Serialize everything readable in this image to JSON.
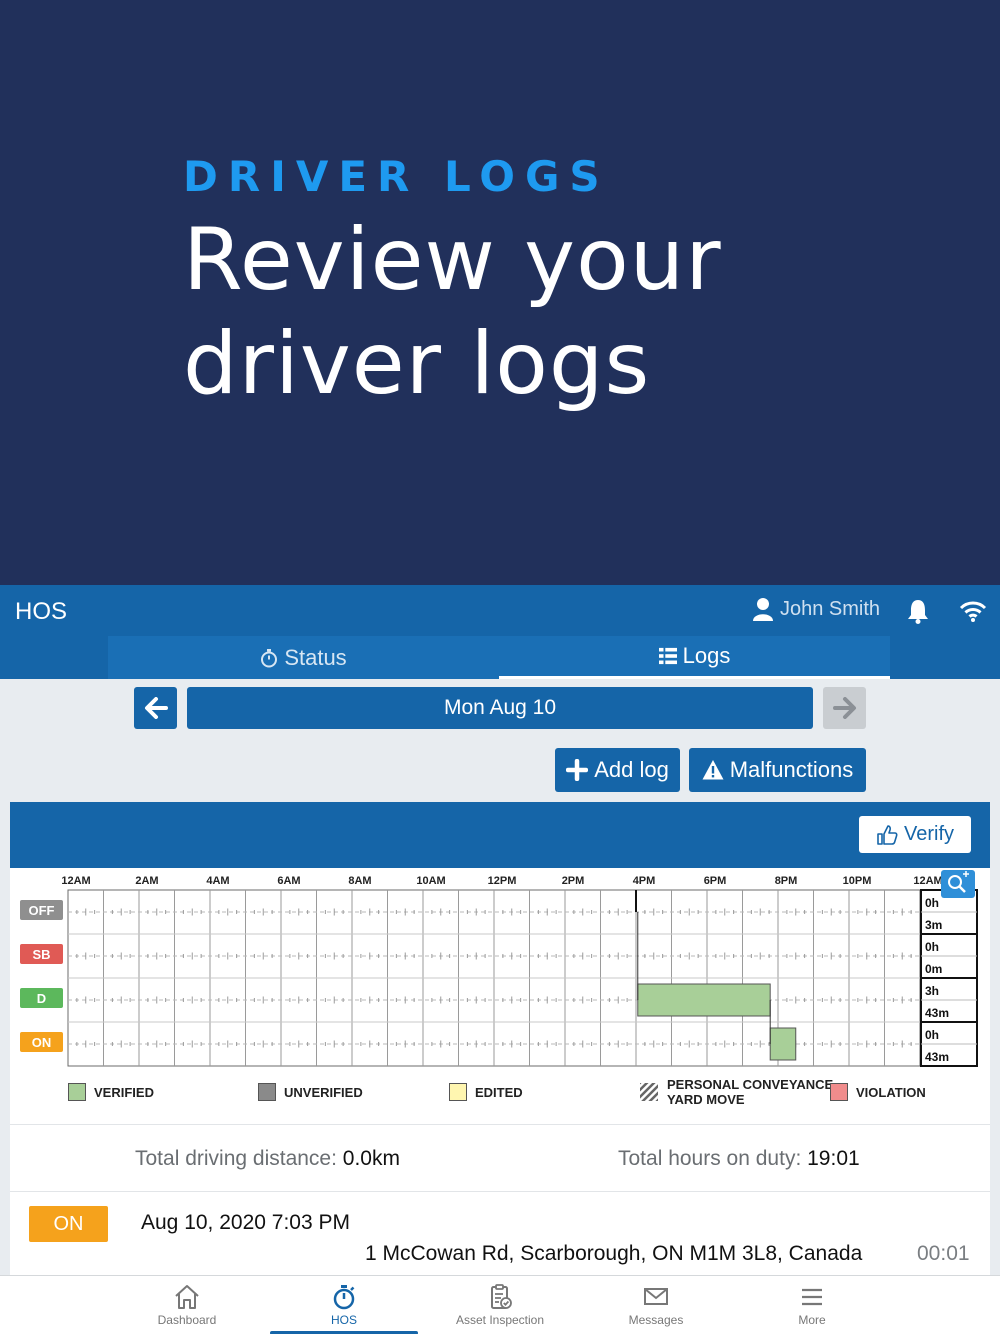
{
  "promo": {
    "kicker": "DRIVER LOGS",
    "title": "Review your driver logs"
  },
  "appbar": {
    "title": "HOS",
    "user_name": "John Smith",
    "user_icon": "user-icon",
    "notification_icon": "bell-icon",
    "connection_icon": "wifi-icon",
    "tabs": [
      {
        "label": "Status",
        "icon": "stopwatch-icon",
        "active": false
      },
      {
        "label": "Logs",
        "icon": "list-icon",
        "active": true
      }
    ]
  },
  "log_nav": {
    "date": "Mon Aug 10",
    "prev_icon": "arrow-left-icon",
    "next_icon": "arrow-right-icon",
    "next_enabled": false
  },
  "actions": {
    "add_log": "Add log",
    "malfunctions": "Malfunctions"
  },
  "verify_label": "Verify",
  "chart_data": {
    "type": "duty-status-grid",
    "hour_labels": [
      "12AM",
      "2AM",
      "4AM",
      "6AM",
      "8AM",
      "10AM",
      "12PM",
      "2PM",
      "4PM",
      "6PM",
      "8PM",
      "10PM",
      "12AM"
    ],
    "status_rows": [
      {
        "code": "OFF",
        "color": "#8f8f8f",
        "total_hours": "0h",
        "total_minutes": "3m"
      },
      {
        "code": "SB",
        "color": "#e05a55",
        "total_hours": "0h",
        "total_minutes": "0m"
      },
      {
        "code": "D",
        "color": "#5cb85c",
        "total_hours": "3h",
        "total_minutes": "43m"
      },
      {
        "code": "ON",
        "color": "#f5a21c",
        "total_hours": "0h",
        "total_minutes": "43m"
      }
    ],
    "segments": [
      {
        "status": "OFF",
        "start_hour": 16.0,
        "end_hour": 16.05
      },
      {
        "status": "D",
        "start_hour": 16.05,
        "end_hour": 19.78,
        "state": "verified"
      },
      {
        "status": "ON",
        "start_hour": 19.78,
        "end_hour": 20.5,
        "state": "verified"
      }
    ],
    "zoom_icon": "zoom-in-icon"
  },
  "legend": [
    {
      "label": "VERIFIED",
      "color": "#a8cf98"
    },
    {
      "label": "UNVERIFIED",
      "color": "#8a8a8a"
    },
    {
      "label": "EDITED",
      "color": "#fff6b0"
    },
    {
      "label": "PERSONAL CONVEYANCE",
      "label2": "YARD MOVE",
      "color": "hatched"
    },
    {
      "label": "VIOLATION",
      "color": "#f08c8c"
    }
  ],
  "stats": {
    "distance_label": "Total driving distance:",
    "distance_value": "0.0km",
    "onduty_label": "Total hours on duty:",
    "onduty_value": "19:01"
  },
  "event": {
    "status": "ON",
    "time": "Aug 10, 2020 7:03 PM",
    "address": "1 McCowan Rd, Scarborough, ON M1M 3L8, Canada",
    "duration": "00:01"
  },
  "bottom_nav": [
    {
      "label": "Dashboard",
      "icon": "home-icon",
      "active": false
    },
    {
      "label": "HOS",
      "icon": "stopwatch-icon",
      "active": true
    },
    {
      "label": "Asset Inspection",
      "icon": "clipboard-check-icon",
      "active": false
    },
    {
      "label": "Messages",
      "icon": "envelope-icon",
      "active": false
    },
    {
      "label": "More",
      "icon": "menu-icon",
      "active": false
    }
  ]
}
